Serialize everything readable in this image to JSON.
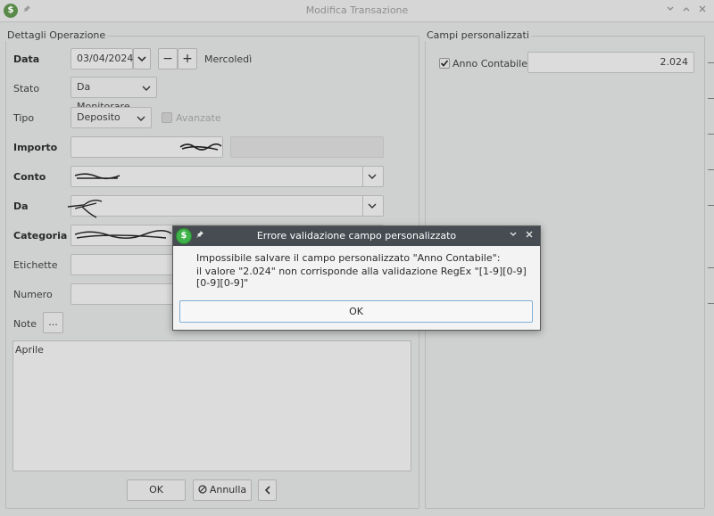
{
  "window": {
    "title": "Modifica Transazione"
  },
  "details": {
    "group_title": "Dettagli Operazione",
    "data_label": "Data",
    "date_value": "03/04/2024",
    "minus": "−",
    "plus": "+",
    "weekday": "Mercoledì",
    "stato_label": "Stato",
    "stato_value": "Da Monitorare",
    "tipo_label": "Tipo",
    "tipo_value": "Deposito",
    "avanzate_label": "Avanzate",
    "importo_label": "Importo",
    "conto_label": "Conto",
    "da_label": "Da",
    "categoria_label": "Categoria",
    "etichette_label": "Etichette",
    "numero_label": "Numero",
    "note_label": "Note",
    "note_button": "...",
    "notes_text": "Aprile"
  },
  "footer": {
    "ok": "OK",
    "annulla": "Annulla",
    "back_icon": "chevron-left"
  },
  "custom": {
    "group_title": "Campi personalizzati",
    "anno_label": "Anno Contabile",
    "anno_value": "2.024"
  },
  "dialog": {
    "title": "Errore validazione campo personalizzato",
    "line1": "Impossibile salvare il campo personalizzato \"Anno Contabile\":",
    "line2": "il valore \"2.024\" non corrisponde alla validazione RegEx \"[1-9][0-9][0-9][0-9]\"",
    "ok": "OK"
  },
  "colors": {
    "dialog_title_bg": "#464c52",
    "logo_green": "#3fb34a",
    "ok_focus_border": "#7fb0d8"
  }
}
